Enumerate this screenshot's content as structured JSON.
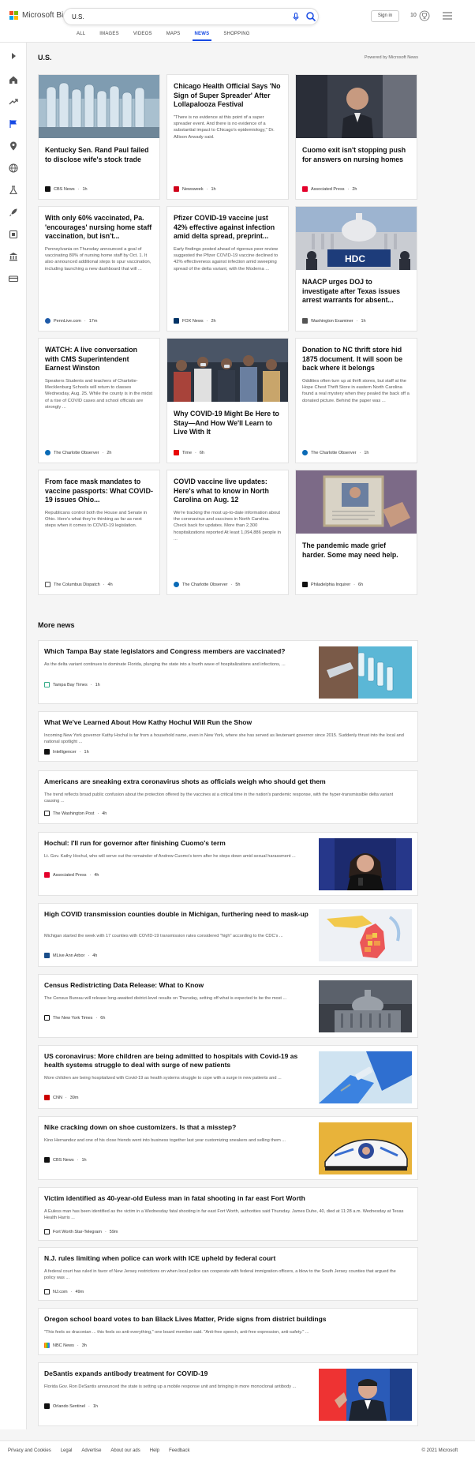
{
  "header": {
    "logo_text": "Microsoft Bing",
    "search_value": "U.S.",
    "signin_label": "Sign in",
    "rewards_count": "10",
    "tabs": [
      {
        "label": "ALL"
      },
      {
        "label": "IMAGES"
      },
      {
        "label": "VIDEOS"
      },
      {
        "label": "MAPS"
      },
      {
        "label": "NEWS"
      },
      {
        "label": "SHOPPING"
      }
    ],
    "active_tab": "NEWS"
  },
  "main": {
    "section_title": "U.S.",
    "powered_by": "Powered by Microsoft News",
    "cards": [
      {
        "title": "Kentucky Sen. Rand Paul failed to disclose wife's stock trade",
        "source": "CBS News",
        "time": "1h",
        "image": "glass-tubes"
      },
      {
        "title": "Chicago Health Official Says 'No Sign of Super Spreader' After Lollapalooza Festival",
        "description": "\"There is no evidence at this point of a super spreader event. And there is no evidence of a substantial impact to Chicago's epidemiology,\" Dr. Allison Arwady said.",
        "source": "Newsweek",
        "time": "1h"
      },
      {
        "title": "Cuomo exit isn't stopping push for answers on nursing homes",
        "source": "Associated Press",
        "time": "2h",
        "image": "cuomo"
      },
      {
        "title": "With only 60% vaccinated, Pa. 'encourages' nursing home staff vaccination, but isn't...",
        "description": "Pennsylvania on Thursday announced a goal of vaccinating 80% of nursing home staff by Oct. 1. It also announced additional steps to spur vaccination, including launching a new dashboard that will ...",
        "source": "PennLive.com",
        "time": "17m"
      },
      {
        "title": "Pfizer COVID-19 vaccine just 42% effective against infection amid delta spread, preprint...",
        "description": "Early findings posted ahead of rigorous peer review suggested the Pfizer COVID-19 vaccine declined to 42% effectiveness against infection amid sweeping spread of the delta variant, with the Moderna ...",
        "source": "FOX News",
        "time": "2h"
      },
      {
        "title": "NAACP urges DOJ to investigate after Texas issues arrest warrants for absent...",
        "source": "Washington Examiner",
        "time": "1h",
        "image": "capitol-hdc"
      },
      {
        "title": "WATCH: A live conversation with CMS Superintendent Earnest Winston",
        "description": "Speakers Students and teachers of Charlotte-Mecklenburg Schools will return to classes Wednesday, Aug. 25. While the county is in the midst of a rise of COVID cases and school officials are strongly ...",
        "source": "The Charlotte Observer",
        "time": "2h"
      },
      {
        "title": "Why COVID-19 Might Be Here to Stay—And How We'll Learn to Live With It",
        "source": "Time",
        "time": "6h",
        "image": "crowd"
      },
      {
        "title": "Donation to NC thrift store hid 1875 document. It will soon be back where it belongs",
        "description": "Oddities often turn up at thrift stores, but staff at the Hope Chest Thrift Store in eastern North Carolina found a real mystery when they pealed the back off a donated picture. Behind the paper was ...",
        "source": "The Charlotte Observer",
        "time": "1h"
      },
      {
        "title": "From face mask mandates to vaccine passports: What COVID-19 issues Ohio...",
        "description": "Republicans control both the House and Senate in Ohio. Here's what they're thinking as far as next steps when it comes to COVID-19 legislation.",
        "source": "The Columbus Dispatch",
        "time": "4h"
      },
      {
        "title": "COVID vaccine live updates: Here's what to know in North Carolina on Aug. 12",
        "description": "We're tracking the most up-to-date information about the coronavirus and vaccines in North Carolina. Check back for updates. More than 2,300 hospitalizations reported At least 1,094,886 people in ...",
        "source": "The Charlotte Observer",
        "time": "5h"
      },
      {
        "title": "The pandemic made grief harder. Some may need help.",
        "source": "Philadelphia Inquirer",
        "time": "6h",
        "image": "photo-frame"
      }
    ],
    "more_news_title": "More news",
    "more_news": [
      {
        "title": "Which Tampa Bay state legislators and Congress members are vaccinated?",
        "description": "As the delta variant continues to dominate Florida, plunging the state into a fourth wave of hospitalizations and infections, ...",
        "source": "Tampa Bay Times",
        "time": "1h",
        "image": "vaccine-vials"
      },
      {
        "title": "What We've Learned About How Kathy Hochul Will Run the Show",
        "description": "Incoming New York governor Kathy Hochul is far from a household name, even in New York, where she has served as lieutenant governor since 2015. Suddenly thrust into the local and national spotlight ...",
        "source": "Intelligencer",
        "time": "1h"
      },
      {
        "title": "Americans are sneaking extra coronavirus shots as officials weigh who should get them",
        "description": "The trend reflects broad public confusion about the protection offered by the vaccines at a critical time in the nation's pandemic response, with the hyper-transmissible delta variant causing ...",
        "source": "The Washington Post",
        "time": "4h"
      },
      {
        "title": "Hochul: I'll run for governor after finishing Cuomo's term",
        "description": "Lt. Gov. Kathy Hochul, who will serve out the remainder of Andrew Cuomo's term after he steps down amid sexual harassment ...",
        "source": "Associated Press",
        "time": "4h",
        "image": "hochul"
      },
      {
        "title": "High COVID transmission counties double in Michigan, furthering need to mask-up",
        "description": "Michigan started the week with 17 counties with COVID-19 transmission rates considered \"high\" according to the CDC's ...",
        "source": "MLive Ann Arbor",
        "time": "4h",
        "image": "michigan-map"
      },
      {
        "title": "Census Redistricting Data Release: What to Know",
        "description": "The Census Bureau will release long-awaited district-level results on Thursday, setting off what is expected to be the most ...",
        "source": "The New York Times",
        "time": "6h",
        "image": "capitol-dark"
      },
      {
        "title": "US coronavirus: More children are being admitted to hospitals with Covid-19 as health systems struggle to deal with surge of new patients",
        "description": "More children are being hospitalized with Covid-19 as health systems struggle to cope with a surge in new patients and ...",
        "source": "CNN",
        "time": "39m",
        "image": "vaccine-gloves"
      },
      {
        "title": "Nike cracking down on shoe customizers. Is that a misstep?",
        "description": "Kino Hernandez and one of his close friends went into business together last year customizing sneakers and selling them ...",
        "source": "CBS News",
        "time": "1h",
        "image": "sneaker"
      },
      {
        "title": "Victim identified as 40-year-old Euless man in fatal shooting in far east Fort Worth",
        "description": "A Euless man has been identified as the victim in a Wednesday fatal shooting in far east Fort Worth, authorities said Thursday. James Duhe, 40, died at 11:28 a.m. Wednesday at Texas Health Harris ...",
        "source": "Fort Worth Star-Telegram",
        "time": "59m"
      },
      {
        "title": "N.J. rules limiting when police can work with ICE upheld by federal court",
        "description": "A federal court has ruled in favor of New Jersey restrictions on when local police can cooperate with federal immigration officers, a blow to the South Jersey counties that argued the policy was ...",
        "source": "NJ.com",
        "time": "49m"
      },
      {
        "title": "Oregon school board votes to ban Black Lives Matter, Pride signs from district buildings",
        "description": "\"This feels so draconian ... this feels so anti-everything,\" one board member said. \"Anti-free speech, anti-free expression, anti-safety.\" ...",
        "source": "NBC News",
        "time": "3h"
      },
      {
        "title": "DeSantis expands antibody treatment for COVID-19",
        "description": "Florida Gov. Ron DeSantis announced the state is setting up a mobile response unit and bringing in more monoclonal antibody ...",
        "source": "Orlando Sentinel",
        "time": "1h",
        "image": "desantis"
      }
    ]
  },
  "footer": {
    "links": [
      "Privacy and Cookies",
      "Legal",
      "Advertise",
      "About our ads",
      "Help",
      "Feedback"
    ],
    "copyright": "© 2021 Microsoft"
  },
  "colors": {
    "accent": "#174ae4",
    "ms_red": "#f25022",
    "ms_green": "#7fba00",
    "ms_blue": "#00a4ef",
    "ms_yellow": "#ffb900"
  }
}
